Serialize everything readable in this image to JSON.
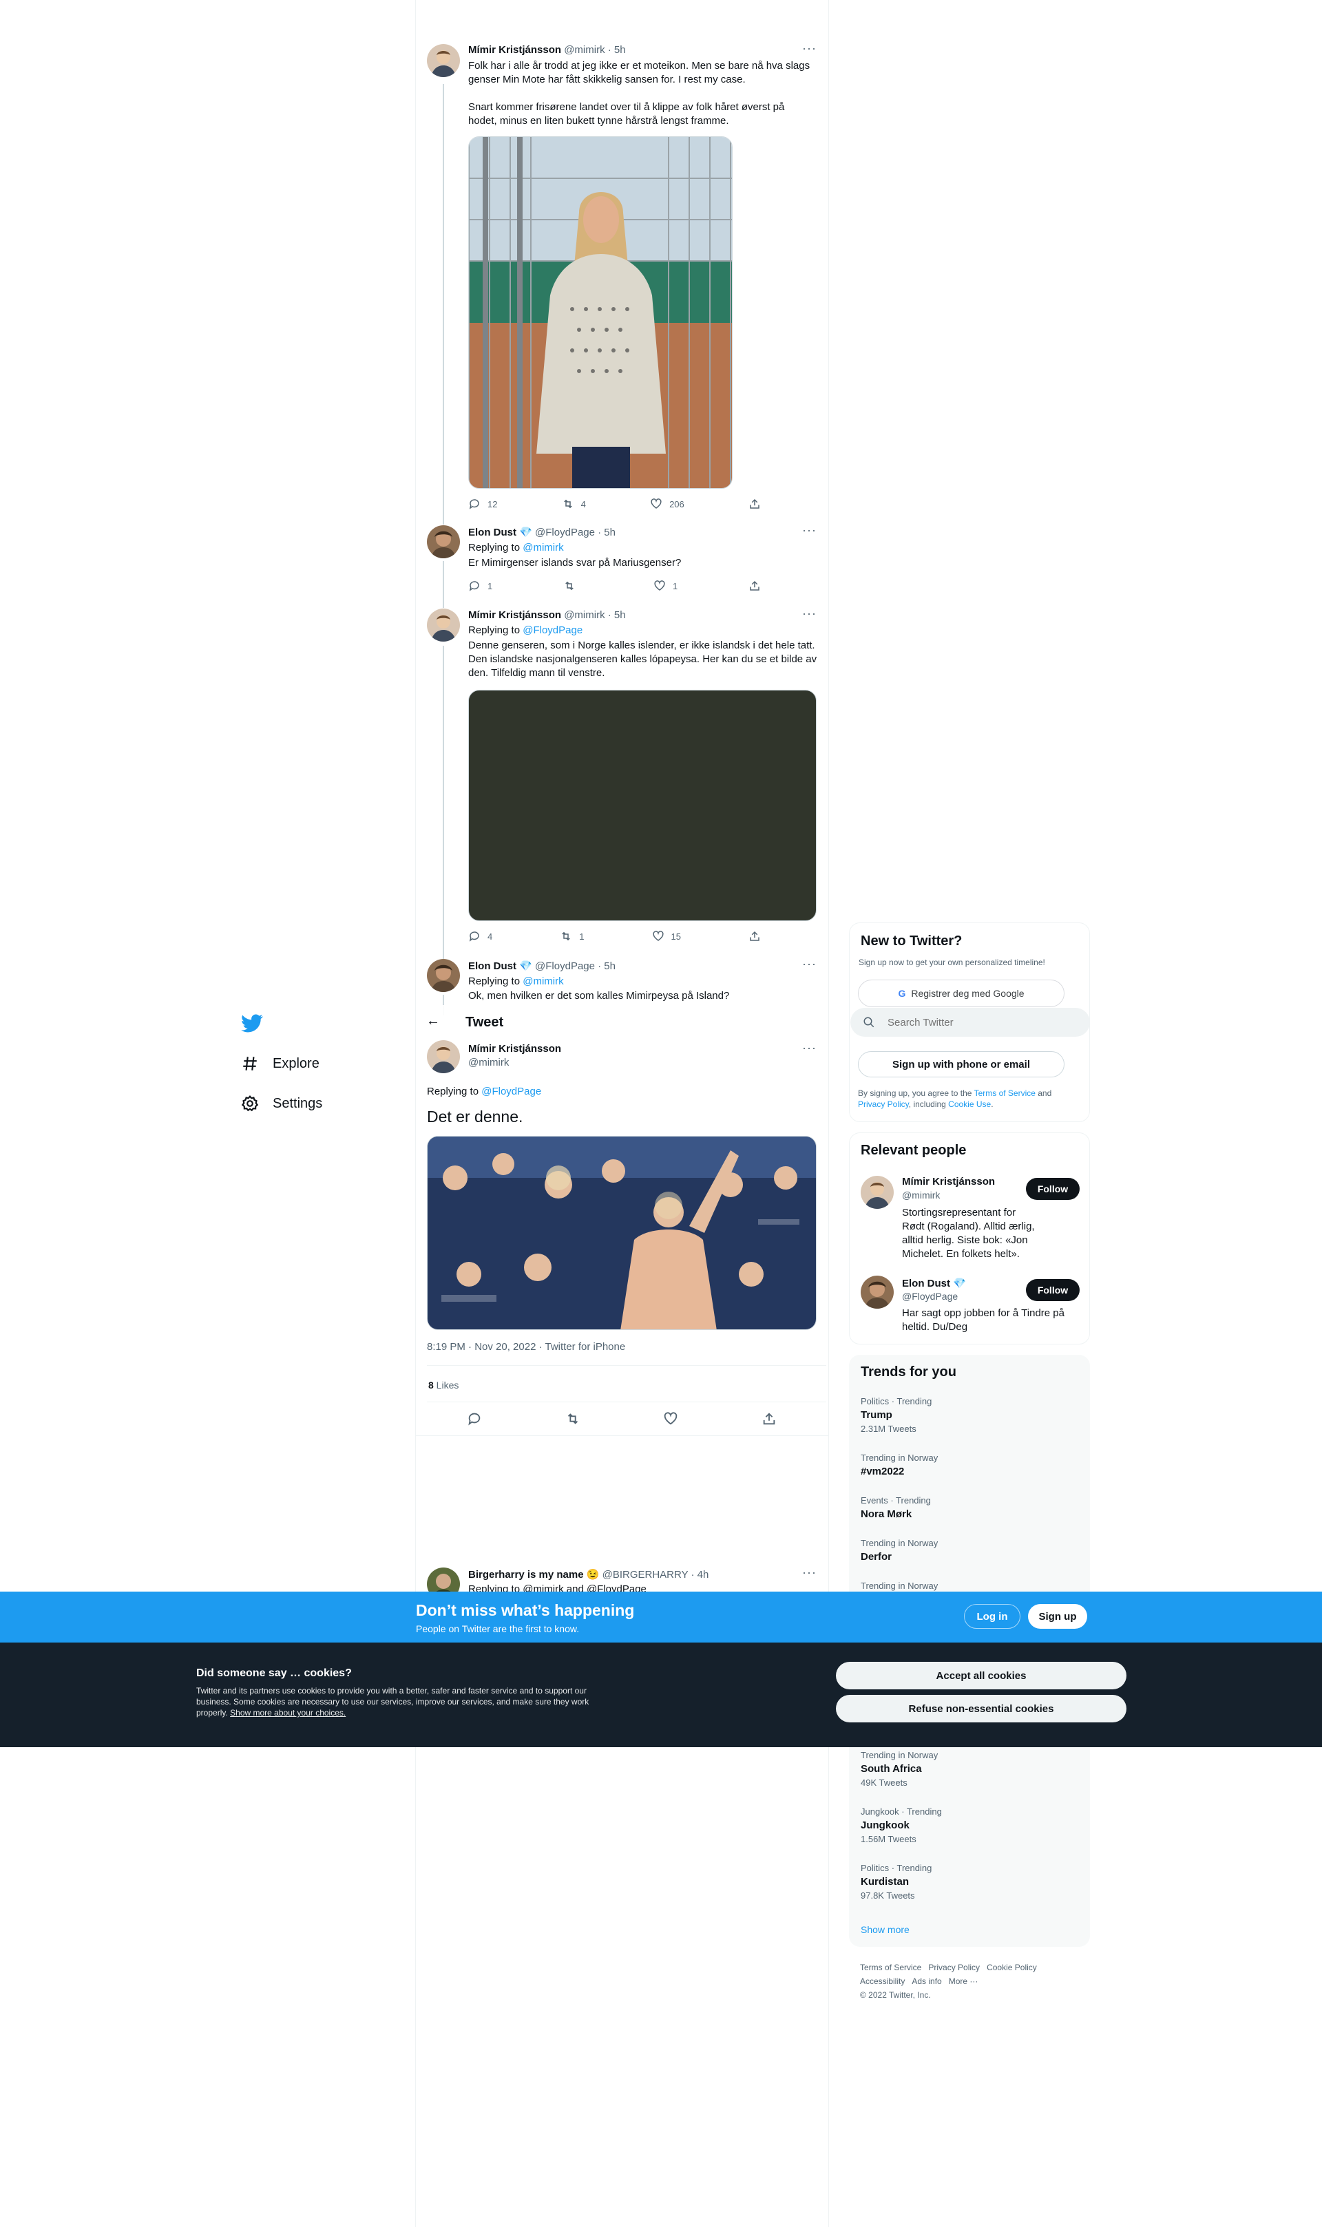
{
  "nav": {
    "explore": "Explore",
    "settings": "Settings"
  },
  "thread": [
    {
      "name": "Mímir Kristjánsson",
      "handle": "@mimirk · 5h",
      "text_1": "Folk har i alle år trodd at jeg ikke er et moteikon. Men se bare nå hva slags genser Min Mote har fått skikkelig sansen for. I rest my case.",
      "text_2": "Snart kommer frisørene landet over til å klippe av folk håret øverst på hodet, minus en liten bukett tynne hårstrå lengst framme.",
      "replies": "12",
      "retweets": "4",
      "likes": "206"
    },
    {
      "name": "Elon Dust",
      "handle": "@FloydPage · 5h",
      "replying_prefix": "Replying to ",
      "replying_to": "@mimirk",
      "text": "Er Mimirgenser islands svar på Mariusgenser?",
      "replies": "1",
      "retweets": "",
      "likes": "1"
    },
    {
      "name": "Mímir Kristjánsson",
      "handle": "@mimirk · 5h",
      "replying_prefix": "Replying to ",
      "replying_to": "@FloydPage",
      "text": "Denne genseren, som i Norge kalles islender, er ikke islandsk i det hele tatt. Den islandske nasjonalgenseren kalles lópapeysa. Her kan du se et bilde av den. Tilfeldig mann til venstre.",
      "replies": "4",
      "retweets": "1",
      "likes": "15"
    },
    {
      "name": "Elon Dust",
      "handle": "@FloydPage · 5h",
      "replying_prefix": "Replying to ",
      "replying_to": "@mimirk",
      "text": "Ok, men hvilken er det som kalles Mimirpeysa på Island?"
    }
  ],
  "main_tweet": {
    "header": "Tweet",
    "name": "Mímir Kristjánsson",
    "handle": "@mimirk",
    "replying_prefix": "Replying to ",
    "replying_to": "@FloydPage",
    "text": "Det er denne.",
    "meta": "8:19 PM · Nov 20, 2022 · Twitter for iPhone",
    "likes_count": "8",
    "likes_label": " Likes"
  },
  "reply_preview": {
    "name": "Birgerharry is my name 😉",
    "handle": "@BIRGERHARRY · 4h",
    "replying": "Replying to @mimirk and @FloydPage"
  },
  "sidebar": {
    "new_title": "New to Twitter?",
    "new_sub": "Sign up now to get your own personalized timeline!",
    "google_btn": "Registrer deg med Google",
    "search_placeholder": "Search Twitter",
    "signup_btn": "Sign up with phone or email",
    "terms_1": "By signing up, you agree to the ",
    "terms_link_1": "Terms of Service",
    "terms_2": " and",
    "terms_link_2": "Privacy Policy",
    "terms_3": ", including ",
    "terms_link_3": "Cookie Use",
    "terms_4": ".",
    "relevant_title": "Relevant people",
    "people": [
      {
        "name": "Mímir Kristjánsson",
        "handle": "@mimirk",
        "bio": "Stortingsrepresentant for Rødt (Rogaland). Alltid ærlig, alltid herlig. Siste bok: «Jon Michelet. En folkets helt».",
        "follow": "Follow"
      },
      {
        "name": "Elon Dust",
        "handle": "@FloydPage",
        "bio": "Har sagt opp jobben for å Tindre på heltid. Du/Deg",
        "follow": "Follow"
      }
    ],
    "trends_title": "Trends for you",
    "trends_top": [
      {
        "context": "Politics · Trending",
        "name": "Trump",
        "count": "2.31M Tweets"
      },
      {
        "context": "Trending in Norway",
        "name": "#vm2022",
        "count": ""
      },
      {
        "context": "Events · Trending",
        "name": "Nora Mørk",
        "count": ""
      },
      {
        "context": "Trending in Norway",
        "name": "Derfor",
        "count": ""
      },
      {
        "context": "Trending in Norway",
        "name": "",
        "count": ""
      }
    ],
    "trends_bottom": [
      {
        "context": "Trending in Norway",
        "name": "South Africa",
        "count": "49K Tweets"
      },
      {
        "context": "Jungkook · Trending",
        "name": "Jungkook",
        "count": "1.56M Tweets"
      },
      {
        "context": "Politics · Trending",
        "name": "Kurdistan",
        "count": "97.8K Tweets"
      }
    ],
    "show_more": "Show more",
    "footer": {
      "terms": "Terms of Service",
      "privacy": "Privacy Policy",
      "cookie": "Cookie Policy",
      "accessibility": "Accessibility",
      "ads": "Ads info",
      "more": "More ···",
      "copyright": "© 2022 Twitter, Inc."
    }
  },
  "bluebar": {
    "title": "Don’t miss what’s happening",
    "sub": "People on Twitter are the first to know.",
    "login": "Log in",
    "signup": "Sign up"
  },
  "cookies": {
    "title": "Did someone say … cookies?",
    "body": "Twitter and its partners use cookies to provide you with a better, safer and faster service and to support our business. Some cookies are necessary to use our services, improve our services, and make sure they work properly. ",
    "link": "Show more about your choices.",
    "accept": "Accept all cookies",
    "refuse": "Refuse non-essential cookies"
  },
  "colors": {
    "accent": "#1d9bf0",
    "text": "#0f1419",
    "muted": "#536471",
    "cookie_bg": "#15202b"
  }
}
